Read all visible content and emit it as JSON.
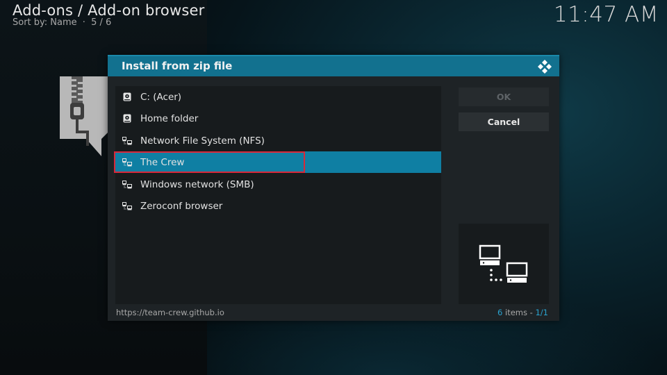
{
  "header": {
    "title": "Add-ons / Add-on browser",
    "sort_label": "Sort by: Name",
    "sort_sep": "·",
    "position": "5 / 6"
  },
  "clock": "11:47 AM",
  "dialog": {
    "title": "Install from zip file",
    "items": [
      {
        "label": "C: (Acer)",
        "icon": "hard-drive-icon"
      },
      {
        "label": "Home folder",
        "icon": "hard-drive-icon"
      },
      {
        "label": "Network File System (NFS)",
        "icon": "network-icon"
      },
      {
        "label": "The Crew",
        "icon": "network-icon",
        "selected": true
      },
      {
        "label": "Windows network (SMB)",
        "icon": "network-icon"
      },
      {
        "label": "Zeroconf browser",
        "icon": "network-icon"
      }
    ],
    "ok_label": "OK",
    "cancel_label": "Cancel",
    "path": "https://team-crew.github.io",
    "count": {
      "items_num": "6",
      "items_word": "items",
      "dash": "-",
      "page": "1/1"
    }
  },
  "colors": {
    "accent": "#12718f",
    "selected_row": "#0f7fa3",
    "highlight_outline": "#d8283a",
    "highlight_text": "#2aa3cf"
  }
}
